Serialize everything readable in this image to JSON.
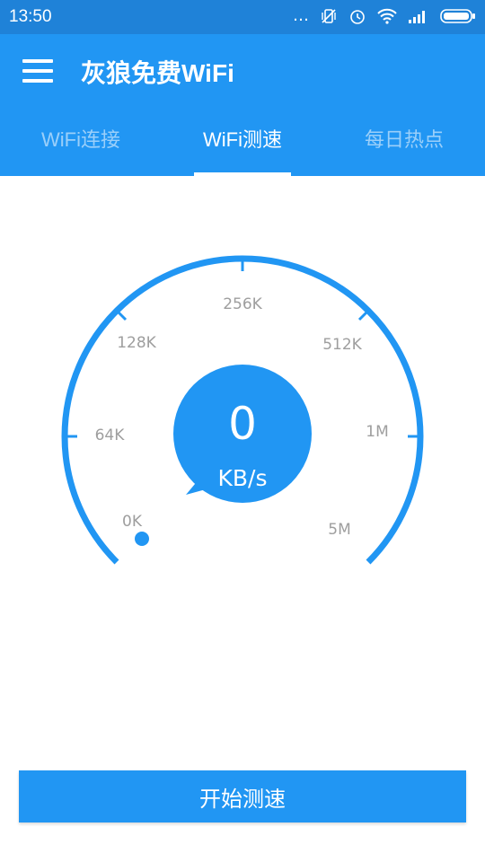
{
  "status": {
    "time": "13:50",
    "icons": [
      "more-dots-icon",
      "vibrate-icon",
      "alarm-icon",
      "wifi-icon",
      "signal-icon",
      "battery-icon"
    ]
  },
  "app": {
    "title": "灰狼免费WiFi",
    "menu_icon": "hamburger-menu-icon"
  },
  "tabs": [
    {
      "label": "WiFi连接",
      "active": false
    },
    {
      "label": "WiFi测速",
      "active": true
    },
    {
      "label": "每日热点",
      "active": false
    }
  ],
  "gauge": {
    "labels": [
      "0K",
      "64K",
      "128K",
      "256K",
      "512K",
      "1M",
      "5M"
    ],
    "value": "0",
    "unit": "KB/s"
  },
  "action": {
    "start_label": "开始测速"
  },
  "colors": {
    "primary": "#2196f3",
    "status_bar": "#1f82d8",
    "label_gray": "#9e9e9e"
  }
}
